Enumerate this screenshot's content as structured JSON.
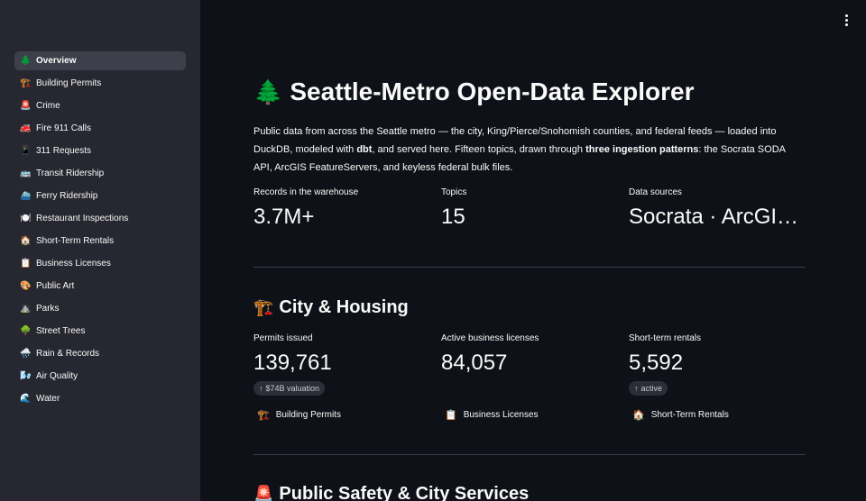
{
  "sidebar": {
    "items": [
      {
        "label": "Overview",
        "icon": "🌲",
        "active": true
      },
      {
        "label": "Building Permits",
        "icon": "🏗️"
      },
      {
        "label": "Crime",
        "icon": "🚨"
      },
      {
        "label": "Fire 911 Calls",
        "icon": "🚒"
      },
      {
        "label": "311 Requests",
        "icon": "📱"
      },
      {
        "label": "Transit Ridership",
        "icon": "🚌"
      },
      {
        "label": "Ferry Ridership",
        "icon": "⛴️"
      },
      {
        "label": "Restaurant Inspections",
        "icon": "🍽️"
      },
      {
        "label": "Short-Term Rentals",
        "icon": "🏠"
      },
      {
        "label": "Business Licenses",
        "icon": "📋"
      },
      {
        "label": "Public Art",
        "icon": "🎨"
      },
      {
        "label": "Parks",
        "icon": "⛰️"
      },
      {
        "label": "Street Trees",
        "icon": "🌳"
      },
      {
        "label": "Rain & Records",
        "icon": "🌧️"
      },
      {
        "label": "Air Quality",
        "icon": "🌬️"
      },
      {
        "label": "Water",
        "icon": "🌊"
      }
    ]
  },
  "main": {
    "title_icon": "🌲",
    "title": "Seattle-Metro Open-Data Explorer",
    "intro": {
      "p1": "Public data from across the Seattle metro — the city, King/Pierce/Snohomish counties, and federal feeds — loaded into DuckDB, modeled with ",
      "b1": "dbt",
      "p2": ", and served here. Fifteen topics, drawn through ",
      "b2": "three ingestion patterns",
      "p3": ": the Socrata SODA API, ArcGIS FeatureServers, and keyless federal bulk files."
    },
    "overview_metrics": [
      {
        "label": "Records in the warehouse",
        "value": "3.7M+"
      },
      {
        "label": "Topics",
        "value": "15"
      },
      {
        "label": "Data sources",
        "value": "Socrata · ArcGI…"
      }
    ],
    "sections": [
      {
        "icon": "🏗️",
        "title": "City & Housing",
        "metrics": [
          {
            "label": "Permits issued",
            "value": "139,761",
            "delta": "$74B valuation",
            "delta_arrow": "↑"
          },
          {
            "label": "Active business licenses",
            "value": "84,057"
          },
          {
            "label": "Short-term rentals",
            "value": "5,592",
            "delta": "active",
            "delta_arrow": "↑"
          }
        ],
        "links": [
          {
            "icon": "🏗️",
            "label": "Building Permits"
          },
          {
            "icon": "📋",
            "label": "Business Licenses"
          },
          {
            "icon": "🏠",
            "label": "Short-Term Rentals"
          }
        ]
      },
      {
        "icon": "🚨",
        "title": "Public Safety & City Services"
      }
    ]
  },
  "toolbar": {
    "menu_icon": "kebab-menu-icon"
  }
}
